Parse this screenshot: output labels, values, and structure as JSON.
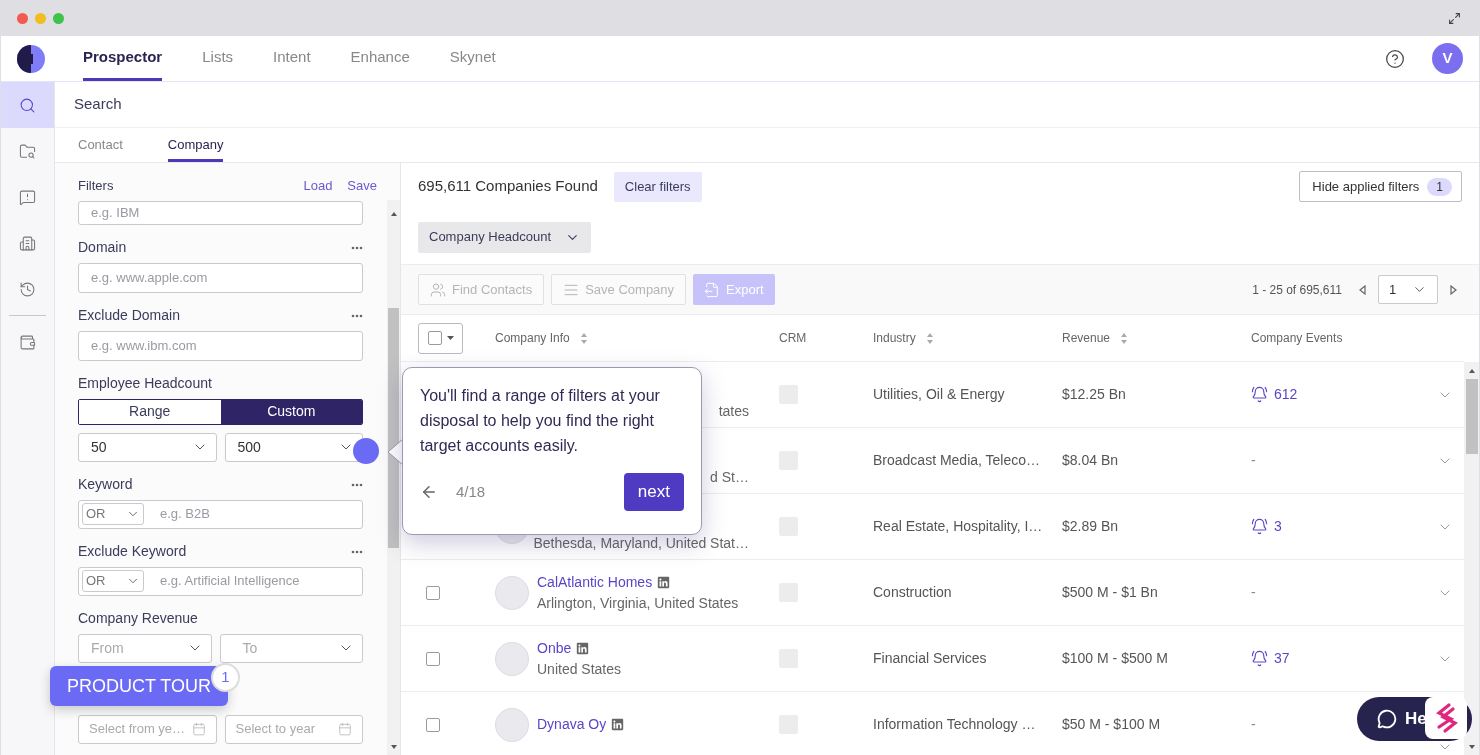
{
  "nav": {
    "tabs": [
      {
        "label": "Prospector",
        "selected": true
      },
      {
        "label": "Lists",
        "selected": false
      },
      {
        "label": "Intent",
        "selected": false
      },
      {
        "label": "Enhance",
        "selected": false
      },
      {
        "label": "Skynet",
        "selected": false
      }
    ],
    "avatar": "V"
  },
  "sidebar": {
    "items": [
      {
        "selected": true
      },
      {
        "selected": false
      },
      {
        "selected": false
      },
      {
        "selected": false
      },
      {
        "selected": false
      },
      {
        "selected": false
      }
    ]
  },
  "page_title": "Search",
  "subtabs": [
    {
      "label": "Contact",
      "selected": false
    },
    {
      "label": "Company",
      "selected": true
    }
  ],
  "filters": {
    "title": "Filters",
    "actions": [
      "Load",
      "Save"
    ],
    "fields": [
      {
        "kind": "text",
        "placeholder": "e.g. IBM"
      },
      {
        "kind": "text",
        "label": "Domain",
        "placeholder": "e.g. www.apple.com",
        "menu": true
      },
      {
        "kind": "text",
        "label": "Exclude Domain",
        "placeholder": "e.g. www.ibm.com",
        "menu": true
      },
      {
        "kind": "segmented",
        "label": "Employee Headcount",
        "options": [
          {
            "label": "Range",
            "selected": false
          },
          {
            "label": "Custom",
            "selected": true
          }
        ]
      },
      {
        "kind": "range",
        "from": {
          "value": "50"
        },
        "to": {
          "value": "500"
        }
      },
      {
        "kind": "keyword",
        "label": "Keyword",
        "operator": "OR",
        "placeholder": "e.g. B2B",
        "menu": true
      },
      {
        "kind": "keyword",
        "label": "Exclude Keyword",
        "operator": "OR",
        "placeholder": "e.g. Artificial Intelligence",
        "menu": true
      },
      {
        "kind": "range",
        "label": "Company Revenue",
        "from": {
          "placeholder": "From"
        },
        "to": {
          "placeholder": "To"
        }
      },
      {
        "kind": "dates",
        "from": "Select from ye…",
        "to": "Select to year"
      }
    ]
  },
  "results": {
    "count": "695,611 Companies Found",
    "clear_button": "Clear filters",
    "hide_button": "Hide applied filters",
    "applied_count": "1",
    "chips": [
      "Company Headcount"
    ],
    "toolbar": [
      {
        "kind": "outline",
        "label": "Find Contacts",
        "disabled": true
      },
      {
        "kind": "outline",
        "label": "Save Company",
        "disabled": true
      },
      {
        "kind": "primary",
        "label": "Export",
        "disabled": true
      }
    ],
    "pagination": {
      "range": "1 - 25 of 695,611",
      "page": "1"
    }
  },
  "table": {
    "select_all_checked": false,
    "columns": [
      {
        "label": "Company Info",
        "sortable": true
      },
      {
        "label": "CRM",
        "sortable": false
      },
      {
        "label": "Industry",
        "sortable": true
      },
      {
        "label": "Revenue",
        "sortable": true
      },
      {
        "label": "Company Events",
        "sortable": false
      }
    ],
    "rows": [
      {
        "location": "tates",
        "logo": false,
        "linkedin": false,
        "industry": "Utilities, Oil & Energy",
        "revenue": "$12.25 Bn",
        "events": "612",
        "alerts": true
      },
      {
        "location": "d St…",
        "logo": false,
        "linkedin": false,
        "industry": "Broadcast Media, Teleco…",
        "revenue": "$8.04 Bn",
        "events": "-",
        "alerts": false
      },
      {
        "location": "Bethesda, Maryland, United Stat…",
        "logo": true,
        "linkedin": false,
        "industry": "Real Estate, Hospitality, I…",
        "revenue": "$2.89 Bn",
        "events": "3",
        "alerts": true
      },
      {
        "name": "CalAtlantic Homes",
        "location": "Arlington, Virginia, United States",
        "checked": false,
        "logo": true,
        "linkedin": true,
        "industry": "Construction",
        "revenue": "$500 M - $1 Bn",
        "events": "-",
        "alerts": false
      },
      {
        "name": "Onbe",
        "location": "United States",
        "checked": false,
        "logo": true,
        "linkedin": true,
        "industry": "Financial Services",
        "revenue": "$100 M - $500 M",
        "events": "37",
        "alerts": true
      },
      {
        "name": "Dynava Oy",
        "checked": false,
        "logo": true,
        "linkedin": true,
        "industry": "Information Technology …",
        "revenue": "$50 M - $100 M",
        "events": "-",
        "alerts": false
      }
    ]
  },
  "tour_tooltip": {
    "text": "You'll find a range of filters at your disposal to help you find the right target accounts easily.",
    "step": "4/18",
    "next": "next"
  },
  "product_tour": {
    "label": "PRODUCT TOUR",
    "badge": "1"
  },
  "help": {
    "label": "He"
  }
}
